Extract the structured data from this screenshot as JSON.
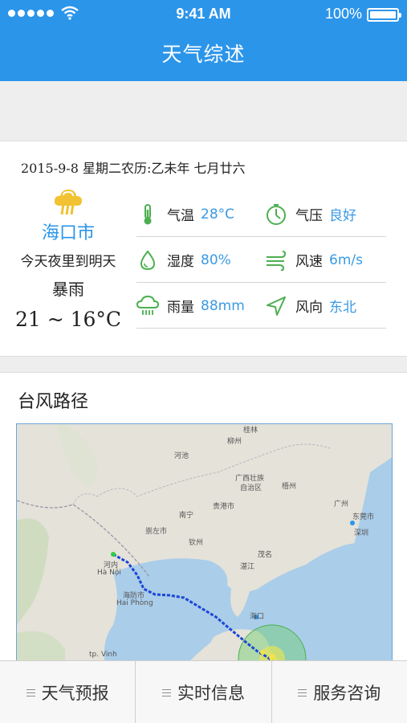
{
  "status_bar": {
    "time": "9:41 AM",
    "battery": "100%"
  },
  "nav": {
    "title": "天气综述"
  },
  "weather": {
    "date_line": "2015-9-8  星期二农历:乙未年  七月廿六",
    "city": "海口市",
    "period": "今天夜里到明天",
    "condition": "暴雨",
    "temp_range": "21 ~ 16°C",
    "rows": [
      [
        {
          "icon": "thermometer-icon",
          "label": "气温",
          "value": "28°C"
        },
        {
          "icon": "pressure-gauge-icon",
          "label": "气压",
          "value": "良好"
        }
      ],
      [
        {
          "icon": "humidity-drop-icon",
          "label": "湿度",
          "value": "80%"
        },
        {
          "icon": "wind-icon",
          "label": "风速",
          "value": "6m/s"
        }
      ],
      [
        {
          "icon": "rain-cloud-icon",
          "label": "雨量",
          "value": "88mm"
        },
        {
          "icon": "wind-direction-arrow-icon",
          "label": "风向",
          "value": "东北"
        }
      ]
    ]
  },
  "typhoon": {
    "title": "台风路径",
    "map_labels": [
      "河池",
      "柳州",
      "桂林",
      "广西壮族",
      "自治区",
      "南宁",
      "贵港市",
      "梧州",
      "广州",
      "东莞市",
      "深圳",
      "崇左市",
      "钦州",
      "茂名",
      "湛江",
      "河内",
      "Hà Nội",
      "海防市",
      "Hai Phòng",
      "海口",
      "tp. Vinh"
    ]
  },
  "tabs": [
    "天气预报",
    "实时信息",
    "服务咨询"
  ],
  "colors": {
    "brand": "#2b95ea",
    "value": "#3a9ae3",
    "icon_green": "#4caf50"
  }
}
